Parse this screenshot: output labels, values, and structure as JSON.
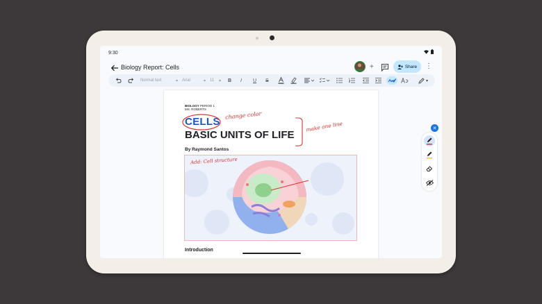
{
  "status": {
    "time": "9:30"
  },
  "appbar": {
    "title": "Biology Report: Cells",
    "share_label": "Share",
    "add": "+",
    "more": "⋮"
  },
  "toolbar": {
    "style": "Normal text",
    "font": "Arial",
    "size": "11"
  },
  "document": {
    "course": "BIOLOGY",
    "period": "PERIOD 1",
    "teacher": "MS. ROBERTS",
    "heading1": "CELLS",
    "heading2": "BASIC UNITS OF LIFE",
    "byline": "By Raymond Santos",
    "section": "Introduction"
  },
  "annotations": {
    "note1": "change color",
    "note2": "make one line",
    "note3": "Add: Cell structure"
  },
  "colors": {
    "accent": "#1a73e8",
    "ink": "#d33333",
    "heading": "#1a56c4",
    "share_bg": "#c2e7ff"
  },
  "icons": [
    "back-arrow-icon",
    "add-icon",
    "comment-icon",
    "share-icon",
    "more-icon",
    "undo-icon",
    "redo-icon",
    "bold-icon",
    "italic-icon",
    "underline-icon",
    "strikethrough-icon",
    "text-color-icon",
    "highlight-icon",
    "align-icon",
    "list-icon",
    "indent-icon",
    "pen-icon",
    "highlighter-icon",
    "eraser-icon",
    "hide-icon"
  ]
}
